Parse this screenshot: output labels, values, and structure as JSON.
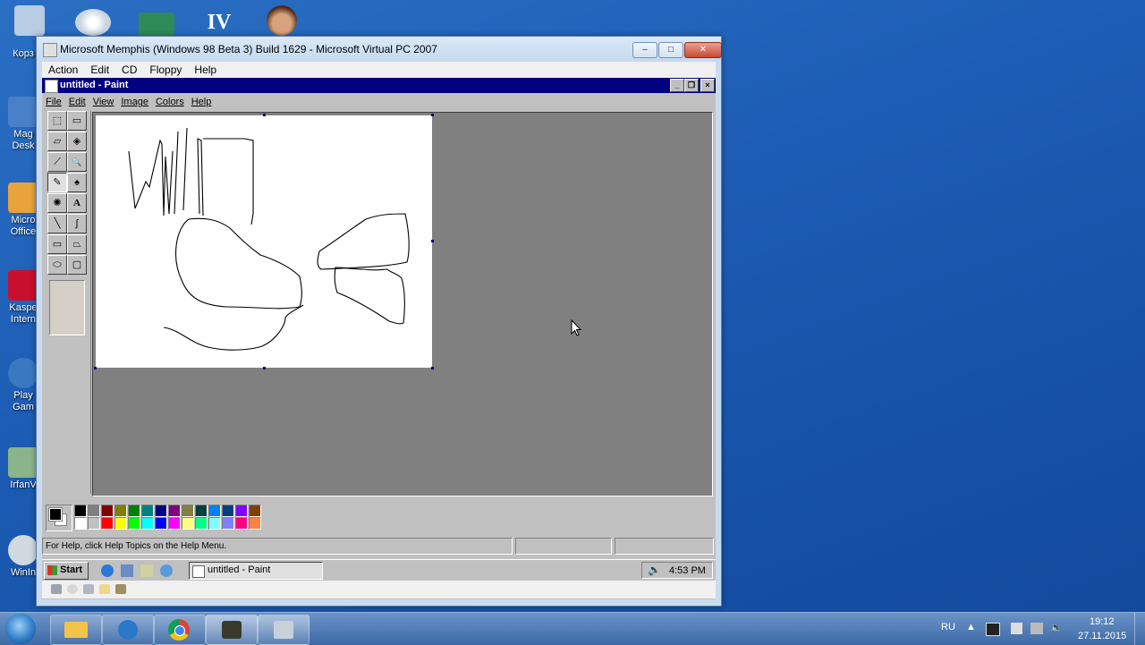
{
  "desktop": {
    "icons": [
      {
        "label": "Корз",
        "color": "#9bb6d6"
      },
      {
        "label": "Mag\nDesk",
        "color": "#4a80c8"
      },
      {
        "label": "Micro\nOffice",
        "color": "#e8a33c"
      },
      {
        "label": "Kaspe\nIntern",
        "color": "#c8102e"
      },
      {
        "label": "Play\nGam",
        "color": "#3a78c0"
      },
      {
        "label": "IrfanV",
        "color": "#8ab48a"
      },
      {
        "label": "WinIn",
        "color": "#d0d8e0"
      }
    ],
    "top_icons": [
      "cd-icon",
      "card-icon",
      "gta-iv-icon",
      "face-icon"
    ],
    "top_icon_text": "IV"
  },
  "vpc_window": {
    "title": "Microsoft Memphis (Windows 98 Beta 3) Build 1629 - Microsoft Virtual PC 2007",
    "menu": [
      "Action",
      "Edit",
      "CD",
      "Floppy",
      "Help"
    ],
    "caption": {
      "minimize": "–",
      "maximize": "□",
      "close": "✕"
    }
  },
  "paint": {
    "title": "untitled - Paint",
    "menu": [
      "File",
      "Edit",
      "View",
      "Image",
      "Colors",
      "Help"
    ],
    "caption": {
      "minimize": "_",
      "restore": "❐",
      "close": "×"
    },
    "tools": [
      {
        "name": "free-select-tool",
        "glyph": "⬚"
      },
      {
        "name": "select-tool",
        "glyph": "▭"
      },
      {
        "name": "eraser-tool",
        "glyph": "▱"
      },
      {
        "name": "fill-tool",
        "glyph": "◈"
      },
      {
        "name": "pick-color-tool",
        "glyph": "⟋"
      },
      {
        "name": "magnifier-tool",
        "glyph": "🔍"
      },
      {
        "name": "pencil-tool",
        "glyph": "✎"
      },
      {
        "name": "brush-tool",
        "glyph": "♠"
      },
      {
        "name": "airbrush-tool",
        "glyph": "✺"
      },
      {
        "name": "text-tool",
        "glyph": "A"
      },
      {
        "name": "line-tool",
        "glyph": "╲"
      },
      {
        "name": "curve-tool",
        "glyph": "∫"
      },
      {
        "name": "rectangle-tool",
        "glyph": "▭"
      },
      {
        "name": "polygon-tool",
        "glyph": "⏢"
      },
      {
        "name": "ellipse-tool",
        "glyph": "⬭"
      },
      {
        "name": "rounded-rect-tool",
        "glyph": "▢"
      }
    ],
    "palette_top": [
      "#000000",
      "#808080",
      "#800000",
      "#808000",
      "#008000",
      "#008080",
      "#000080",
      "#800080",
      "#808040",
      "#004040",
      "#0080ff",
      "#004080",
      "#8000ff",
      "#804000"
    ],
    "palette_bottom": [
      "#ffffff",
      "#c0c0c0",
      "#ff0000",
      "#ffff00",
      "#00ff00",
      "#00ffff",
      "#0000ff",
      "#ff00ff",
      "#ffff80",
      "#00ff80",
      "#80ffff",
      "#8080ff",
      "#ff0080",
      "#ff8040"
    ],
    "status_text": "For Help, click Help Topics on the Help Menu."
  },
  "guest_taskbar": {
    "start": "Start",
    "task": "untitled - Paint",
    "clock": "4:53 PM"
  },
  "win7_taskbar": {
    "lang": "RU",
    "time": "19:12",
    "date": "27.11.2015",
    "apps": [
      "folder-icon",
      "hp-icon",
      "chrome-icon",
      "media-icon",
      "vpc-icon"
    ]
  }
}
